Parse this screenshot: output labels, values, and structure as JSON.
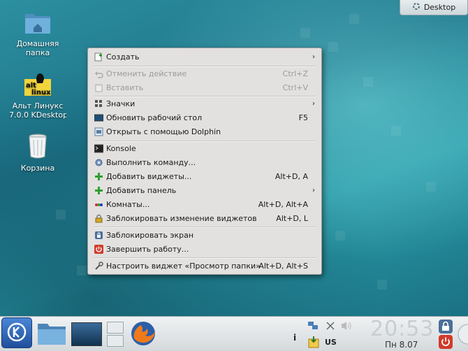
{
  "desktop": {
    "icons": [
      {
        "label_line1": "Домашняя",
        "label_line2": "папка"
      },
      {
        "label_line1": "Альт Линукс",
        "label_line2": "7.0.0 KDesktop"
      },
      {
        "label_line1": "Корзина",
        "label_line2": ""
      }
    ],
    "desktop_button": "Desktop"
  },
  "menu": {
    "items": [
      {
        "label": "Создать",
        "shortcut": "",
        "submenu": true,
        "disabled": false,
        "icon": "new-icon"
      },
      {
        "label": "Отменить действие",
        "shortcut": "Ctrl+Z",
        "submenu": false,
        "disabled": true,
        "icon": "undo-icon"
      },
      {
        "label": "Вставить",
        "shortcut": "Ctrl+V",
        "submenu": false,
        "disabled": true,
        "icon": "paste-icon"
      },
      {
        "label": "Значки",
        "shortcut": "",
        "submenu": true,
        "disabled": false,
        "icon": "icons-icon"
      },
      {
        "label": "Обновить рабочий стол",
        "shortcut": "F5",
        "submenu": false,
        "disabled": false,
        "icon": "refresh-desktop-icon"
      },
      {
        "label": "Открыть с помощью Dolphin",
        "shortcut": "",
        "submenu": false,
        "disabled": false,
        "icon": "dolphin-icon"
      },
      {
        "label": "Konsole",
        "shortcut": "",
        "submenu": false,
        "disabled": false,
        "icon": "terminal-icon"
      },
      {
        "label": "Выполнить команду...",
        "shortcut": "",
        "submenu": false,
        "disabled": false,
        "icon": "run-icon"
      },
      {
        "label": "Добавить виджеты...",
        "shortcut": "Alt+D, A",
        "submenu": false,
        "disabled": false,
        "icon": "add-icon"
      },
      {
        "label": "Добавить панель",
        "shortcut": "",
        "submenu": true,
        "disabled": false,
        "icon": "add-icon"
      },
      {
        "label": "Комнаты...",
        "shortcut": "Alt+D, Alt+A",
        "submenu": false,
        "disabled": false,
        "icon": "activities-icon"
      },
      {
        "label": "Заблокировать изменение виджетов",
        "shortcut": "Alt+D, L",
        "submenu": false,
        "disabled": false,
        "icon": "lock-icon"
      },
      {
        "label": "Заблокировать экран",
        "shortcut": "",
        "submenu": false,
        "disabled": false,
        "icon": "lock-screen-icon"
      },
      {
        "label": "Завершить работу...",
        "shortcut": "",
        "submenu": false,
        "disabled": false,
        "icon": "power-icon"
      },
      {
        "label": "Настроить виджет «Просмотр папки»",
        "shortcut": "Alt+D, Alt+S",
        "submenu": false,
        "disabled": false,
        "icon": "configure-icon"
      }
    ]
  },
  "panel": {
    "clock": "20:53",
    "date": "Пн 8.07",
    "keyboard_layout": "US",
    "info": "i"
  },
  "colors": {
    "menu_bg": "#e2e1df",
    "panel_bg": "#d4d9dc",
    "desktop_bg": "#1d7488"
  }
}
